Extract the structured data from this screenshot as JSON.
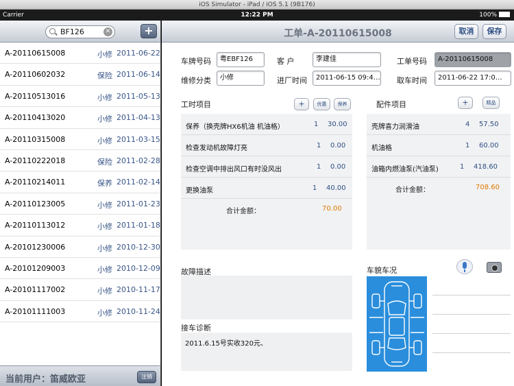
{
  "simulator": {
    "title": "iOS Simulator - iPad / iOS 5.1 (9B176)"
  },
  "statusbar": {
    "carrier": "Carrier",
    "time": "12:22 PM",
    "battery": "100%"
  },
  "left": {
    "search_value": "BF126",
    "add_label": "+",
    "orders": [
      {
        "no": "A-20110615008",
        "type": "小修",
        "date": "2011-06-22"
      },
      {
        "no": "A-20110602032",
        "type": "保险",
        "date": "2011-06-14"
      },
      {
        "no": "A-20110513016",
        "type": "小修",
        "date": "2011-05-13"
      },
      {
        "no": "A-20110413020",
        "type": "小修",
        "date": "2011-04-13"
      },
      {
        "no": "A-20110315008",
        "type": "小修",
        "date": "2011-03-15"
      },
      {
        "no": "A-20110222018",
        "type": "保险",
        "date": "2011-02-28"
      },
      {
        "no": "A-20110214011",
        "type": "保养",
        "date": "2011-02-14"
      },
      {
        "no": "A-20110123005",
        "type": "小修",
        "date": "2011-01-23"
      },
      {
        "no": "A-20110113012",
        "type": "小修",
        "date": "2011-01-18"
      },
      {
        "no": "A-20101230006",
        "type": "小修",
        "date": "2010-12-30"
      },
      {
        "no": "A-20101209003",
        "type": "小修",
        "date": "2010-12-09"
      },
      {
        "no": "A-20101117002",
        "type": "小修",
        "date": "2010-11-17"
      },
      {
        "no": "A-20101111003",
        "type": "小修",
        "date": "2010-11-24"
      }
    ],
    "current_user": "当前用户：笛威欧亚",
    "logout_label": "注销"
  },
  "right": {
    "title": "工单-A-20110615008",
    "cancel_label": "取消",
    "save_label": "保存",
    "form": {
      "plate_label": "车牌号码",
      "plate_value": "粤EBF126",
      "customer_label": "客    户",
      "customer_value": "李建佳",
      "order_no_label": "工单号码",
      "order_no_value": "A-20110615008",
      "category_label": "维修分类",
      "category_value": "小修",
      "in_time_label": "进厂时间",
      "in_time_value": "2011-06-15 09:4…",
      "out_time_label": "取车时间",
      "out_time_value": "2011-06-22 17:0…"
    },
    "labor": {
      "title": "工时项目",
      "add_label": "+",
      "discount_label": "优惠",
      "warranty_label": "保养",
      "items": [
        {
          "name": "保养（换壳牌HX6机油 机油格）",
          "qty": "1",
          "amount": "30.00"
        },
        {
          "name": "检查发动机故障灯亮",
          "qty": "1",
          "amount": "0.00"
        },
        {
          "name": "检查空调中排出风口有时没风出",
          "qty": "1",
          "amount": "0.00"
        },
        {
          "name": "更换油泵",
          "qty": "1",
          "amount": "40.00"
        }
      ],
      "total_label": "合计金额：",
      "total_value": "70.00"
    },
    "parts": {
      "title": "配件项目",
      "add_label": "+",
      "premium_label": "精品",
      "items": [
        {
          "name": "壳牌喜力润滑油",
          "qty": "4",
          "amount": "57.50"
        },
        {
          "name": "机油格",
          "qty": "1",
          "amount": "60.00"
        },
        {
          "name": "油箱内燃油泵(汽油泵)",
          "qty": "1",
          "amount": "418.60"
        }
      ],
      "total_label": "合计金额：",
      "total_value": "708.60"
    },
    "fault_title": "故障描述",
    "diagnosis_title": "接车诊断",
    "diagnosis_text": "2011.6.15号实收320元、",
    "body_title": "车貌车况",
    "icons": {
      "mic": "microphone-icon",
      "camera": "camera-icon"
    }
  }
}
